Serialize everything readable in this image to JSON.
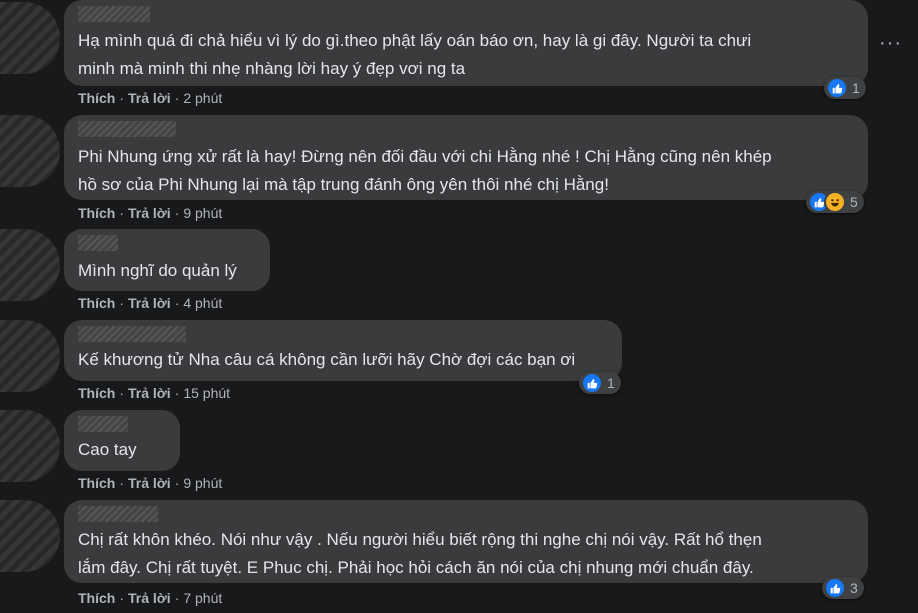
{
  "comments": [
    {
      "lines": [
        "Hạ mình quá đi chả hiểu vì lý do gì.theo phật lấy oán báo ơn, hay là gi đây. Người ta chưi",
        "minh mà minh thi nhẹ nhàng lời hay ý đẹp vơi ng ta"
      ],
      "like": "Thích",
      "reply": "Trả lời",
      "time": "2 phút",
      "reaction_count": "1",
      "reactions": [
        "like-icon"
      ]
    },
    {
      "lines": [
        "Phi Nhung ứng xử rất là hay! Đừng nên đối đầu với chi Hằng nhé ! Chị Hằng cũng nên khép",
        "hồ sơ của Phi Nhung lại mà tập trung đánh ông yên thôi nhé chị Hằng!"
      ],
      "like": "Thích",
      "reply": "Trả lời",
      "time": "9 phút",
      "reaction_count": "5",
      "reactions": [
        "like-icon",
        "haha-icon"
      ]
    },
    {
      "lines": [
        "Mình nghĩ do quản lý"
      ],
      "like": "Thích",
      "reply": "Trả lời",
      "time": "4 phút"
    },
    {
      "lines": [
        "Kế khương tử Nha câu cá không cần lưỡi hãy Chờ đợi các bạn ơi"
      ],
      "like": "Thích",
      "reply": "Trả lời",
      "time": "15 phút",
      "reaction_count": "1",
      "reactions": [
        "like-icon"
      ]
    },
    {
      "lines": [
        "Cao tay"
      ],
      "like": "Thích",
      "reply": "Trả lời",
      "time": "9 phút"
    },
    {
      "lines": [
        "Chị rất khôn khéo. Nói như vậy . Nếu người hiểu biết rộng thi nghe chị nói vậy. Rất hổ thẹn",
        "lắm đây. Chị rất tuyệt. E Phuc chị. Phải học hỏi cách ăn nói của chị nhung mới chuẩn đây."
      ],
      "like": "Thích",
      "reply": "Trả lời",
      "time": "7 phút",
      "reaction_count": "3",
      "reactions": [
        "like-icon"
      ]
    }
  ],
  "separator": "·",
  "more_options": "···",
  "colors": {
    "background": "#18191a",
    "bubble": "#3a3b3c",
    "text": "#e4e6eb",
    "secondary": "#b0b3b8",
    "like_blue": "#1877f2",
    "haha_yellow": "#f7b125"
  }
}
